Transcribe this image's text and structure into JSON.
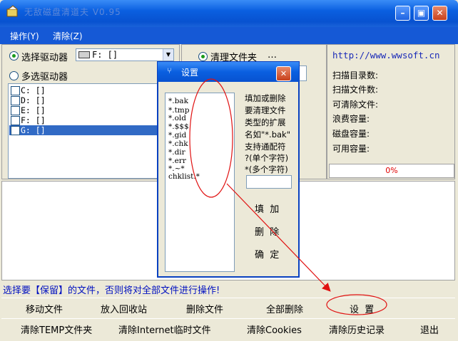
{
  "window": {
    "title": "无敌磁盘清道夫 V0.95"
  },
  "menu": [
    "操作(Y)",
    "清除(Z)"
  ],
  "left": {
    "single_label": "选择驱动器",
    "drive_value": "F: []",
    "multi_label": "多选驱动器",
    "drives": [
      "C: []",
      "D: []",
      "E: []",
      "F: []",
      "G: []"
    ]
  },
  "middle": {
    "clean_folder_label": "清理文件夹",
    "ellipsis": "…"
  },
  "right": {
    "url": "http://www.wwsoft.cn",
    "stats": [
      "扫描目录数:",
      "扫描文件数:",
      "可清除文件:",
      "浪费容量:",
      "磁盘容量:",
      "可用容量:"
    ],
    "progress": "0%"
  },
  "hint": "选择要【保留】的文件，否则将对全部文件进行操作!",
  "buttons_row1": [
    "移动文件",
    "放入回收站",
    "删除文件",
    "全部删除",
    "设  置"
  ],
  "buttons_row2": [
    "清除TEMP文件夹",
    "清除Internet临时文件",
    "清除Cookies",
    "清除历史记录",
    "退出"
  ],
  "dialog": {
    "title": "设置",
    "extensions": [
      "*.bak",
      "*.tmp",
      "*.old",
      "*.$$$",
      "*.gid",
      "*.chk",
      "*.dir",
      "*.err",
      "*.~*",
      "chklist.*"
    ],
    "help_lines": [
      "填加或删除",
      "要清理文件",
      "类型的扩展",
      "名如\"*.bak\"",
      "支持通配符",
      "?(单个字符)",
      "*(多个字符)"
    ],
    "add_label": "填  加",
    "delete_label": "删  除",
    "ok_label": "确  定"
  },
  "colors": {
    "annotation": "#e01010",
    "title_blue": "#0a5fe0",
    "progress_text": "#e00000",
    "hint_text": "#0010c0"
  }
}
